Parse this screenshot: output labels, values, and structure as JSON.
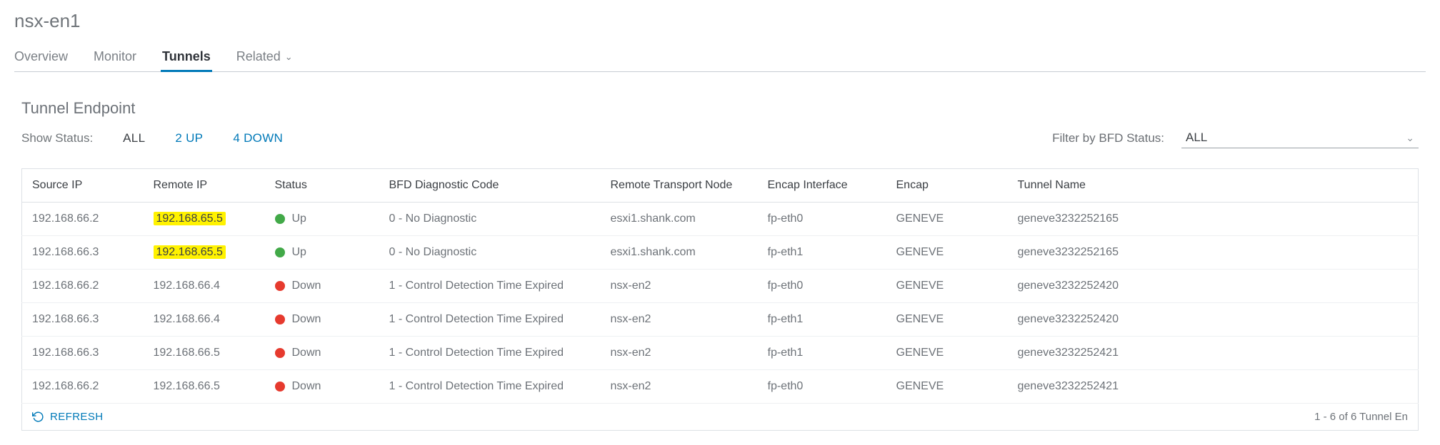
{
  "header": {
    "title": "nsx-en1"
  },
  "tabs": {
    "items": [
      {
        "label": "Overview",
        "active": false,
        "hasChevron": false
      },
      {
        "label": "Monitor",
        "active": false,
        "hasChevron": false
      },
      {
        "label": "Tunnels",
        "active": true,
        "hasChevron": false
      },
      {
        "label": "Related",
        "active": false,
        "hasChevron": true
      }
    ]
  },
  "section": {
    "title": "Tunnel Endpoint"
  },
  "statusFilter": {
    "label": "Show Status:",
    "options": [
      {
        "label": "ALL",
        "link": false
      },
      {
        "label": "2 UP",
        "link": true
      },
      {
        "label": "4 DOWN",
        "link": true
      }
    ]
  },
  "bfdFilter": {
    "label": "Filter by BFD Status:",
    "selected": "ALL"
  },
  "table": {
    "headers": [
      "Source IP",
      "Remote IP",
      "Status",
      "BFD Diagnostic Code",
      "Remote Transport Node",
      "Encap Interface",
      "Encap",
      "Tunnel Name"
    ],
    "colWidths": [
      "170px",
      "170px",
      "160px",
      "310px",
      "220px",
      "180px",
      "170px",
      "auto"
    ],
    "rows": [
      {
        "sourceIp": "192.168.66.2",
        "remoteIp": "192.168.65.5",
        "remoteIpHighlight": true,
        "status": "Up",
        "statusColor": "up",
        "bfd": "0 - No Diagnostic",
        "remoteNode": "esxi1.shank.com",
        "encapIf": "fp-eth0",
        "encap": "GENEVE",
        "tunnelName": "geneve3232252165"
      },
      {
        "sourceIp": "192.168.66.3",
        "remoteIp": "192.168.65.5",
        "remoteIpHighlight": true,
        "status": "Up",
        "statusColor": "up",
        "bfd": "0 - No Diagnostic",
        "remoteNode": "esxi1.shank.com",
        "encapIf": "fp-eth1",
        "encap": "GENEVE",
        "tunnelName": "geneve3232252165"
      },
      {
        "sourceIp": "192.168.66.2",
        "remoteIp": "192.168.66.4",
        "remoteIpHighlight": false,
        "status": "Down",
        "statusColor": "down",
        "bfd": "1 - Control Detection Time Expired",
        "remoteNode": "nsx-en2",
        "encapIf": "fp-eth0",
        "encap": "GENEVE",
        "tunnelName": "geneve3232252420"
      },
      {
        "sourceIp": "192.168.66.3",
        "remoteIp": "192.168.66.4",
        "remoteIpHighlight": false,
        "status": "Down",
        "statusColor": "down",
        "bfd": "1 - Control Detection Time Expired",
        "remoteNode": "nsx-en2",
        "encapIf": "fp-eth1",
        "encap": "GENEVE",
        "tunnelName": "geneve3232252420"
      },
      {
        "sourceIp": "192.168.66.3",
        "remoteIp": "192.168.66.5",
        "remoteIpHighlight": false,
        "status": "Down",
        "statusColor": "down",
        "bfd": "1 - Control Detection Time Expired",
        "remoteNode": "nsx-en2",
        "encapIf": "fp-eth1",
        "encap": "GENEVE",
        "tunnelName": "geneve3232252421"
      },
      {
        "sourceIp": "192.168.66.2",
        "remoteIp": "192.168.66.5",
        "remoteIpHighlight": false,
        "status": "Down",
        "statusColor": "down",
        "bfd": "1 - Control Detection Time Expired",
        "remoteNode": "nsx-en2",
        "encapIf": "fp-eth0",
        "encap": "GENEVE",
        "tunnelName": "geneve3232252421"
      }
    ]
  },
  "footer": {
    "refresh": "REFRESH",
    "count": "1 - 6 of 6 Tunnel En"
  }
}
